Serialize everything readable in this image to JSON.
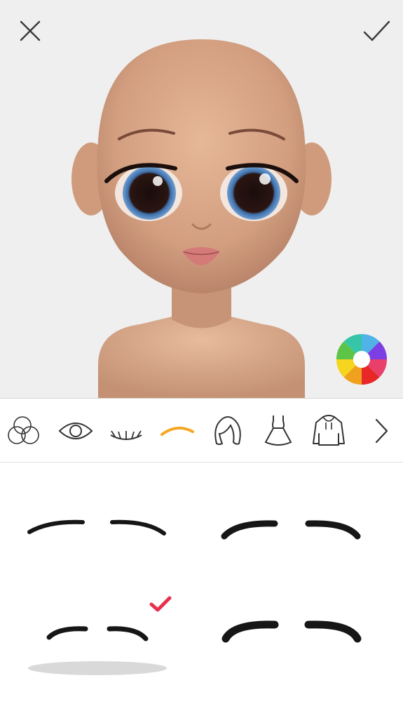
{
  "app": {
    "screen_title": ""
  },
  "top_bar": {
    "close_icon": "close-icon",
    "confirm_icon": "checkmark-icon",
    "close_color": "#3a3a3a",
    "confirm_color": "#3a3a3a"
  },
  "avatar": {
    "skin_color": "#d9a98a",
    "eye_color": "#3d6ea8",
    "lip_color": "#d47a78"
  },
  "color_picker": {
    "icon": "color-wheel-icon",
    "segments": [
      "#4fb3e8",
      "#7c3fe4",
      "#e83f6b",
      "#e82727",
      "#f0a21e",
      "#f5d51e",
      "#5cc447",
      "#37c5a8"
    ]
  },
  "categories": {
    "items": [
      {
        "id": "skin-tone",
        "icon": "circles-icon",
        "selected": false
      },
      {
        "id": "eyes",
        "icon": "eye-icon",
        "selected": false
      },
      {
        "id": "lashes",
        "icon": "eyelashes-icon",
        "selected": false
      },
      {
        "id": "eyebrows",
        "icon": "eyebrow-icon",
        "selected": true
      },
      {
        "id": "hair",
        "icon": "hair-icon",
        "selected": false
      },
      {
        "id": "dress",
        "icon": "dress-icon",
        "selected": false
      },
      {
        "id": "hoodie",
        "icon": "hoodie-icon",
        "selected": false
      },
      {
        "id": "next",
        "icon": "chevron-right-icon",
        "selected": false
      }
    ],
    "accent_color": "#f5a623"
  },
  "eyebrow_options": {
    "items": [
      {
        "id": "brow-1",
        "selected": false
      },
      {
        "id": "brow-2",
        "selected": false
      },
      {
        "id": "brow-3",
        "selected": true
      },
      {
        "id": "brow-4",
        "selected": false
      }
    ],
    "selected_color": "#e8304e"
  }
}
